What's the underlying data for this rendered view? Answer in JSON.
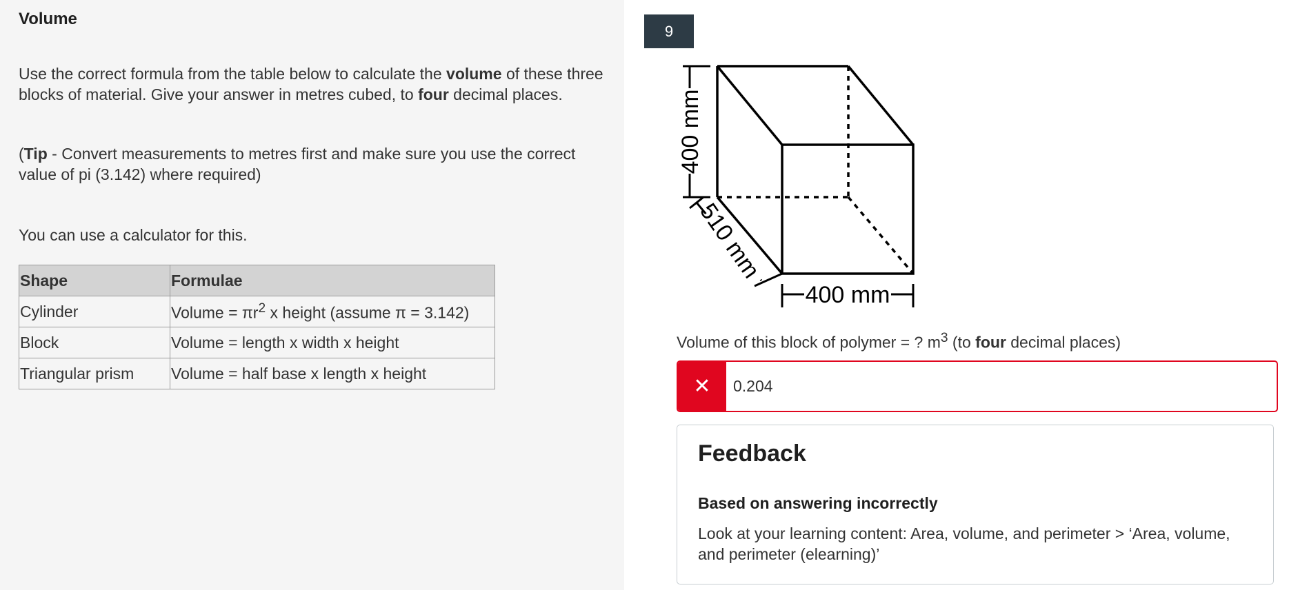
{
  "page": {
    "title": "Volume"
  },
  "instructions": {
    "p1": {
      "a": "Use the correct formula from the table below to calculate the ",
      "b": "volume",
      "c": " of these three blocks of material. Give your answer in metres cubed, to ",
      "d": "four",
      "e": " decimal places."
    },
    "p2": {
      "a": "(",
      "b": "Tip",
      "c": " - Convert measurements to metres first and make sure you use the correct value of pi (3.142) where required)"
    },
    "p3": "You can use a calculator for this."
  },
  "table": {
    "headers": [
      "Shape",
      "Formulae"
    ],
    "rows": [
      {
        "shape": "Cylinder",
        "formula_a": "Volume = πr",
        "formula_sup": "2",
        "formula_b": " x height (assume π = 3.142)"
      },
      {
        "shape": "Block",
        "formula": "Volume = length x width x height"
      },
      {
        "shape": "Triangular prism",
        "formula": "Volume = half base x length x height"
      }
    ]
  },
  "question": {
    "number": "9",
    "diagram": {
      "height_label": "400 mm",
      "depth_label": "510 mm",
      "width_label": "400 mm"
    },
    "prompt": {
      "a": "Volume of this block of polymer = ? m",
      "sup": "3",
      "b": " (to ",
      "c": "four",
      "d": " decimal places)"
    },
    "answer": {
      "value": "0.204",
      "status_icon": "close-icon",
      "status": "incorrect"
    }
  },
  "feedback": {
    "title": "Feedback",
    "subtitle": "Based on answering incorrectly",
    "body": "Look at your learning content: Area, volume, and perimeter > ‘Area, volume, and perimeter (elearning)’"
  },
  "colors": {
    "question_badge": "#2d3b45",
    "error": "#e0061f",
    "table_header": "#d3d3d3",
    "left_panel_bg": "#f5f5f5"
  }
}
